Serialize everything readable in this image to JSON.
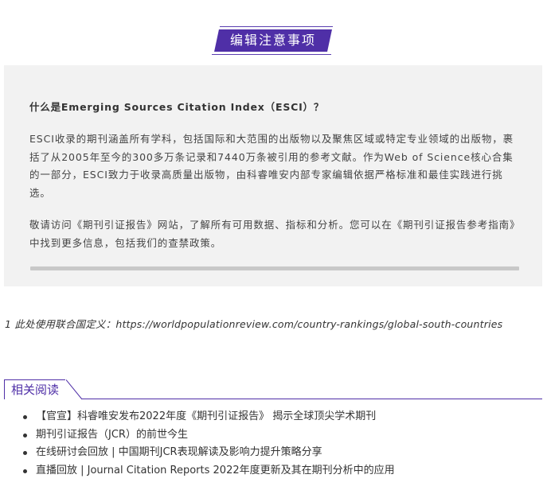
{
  "badge": {
    "label": "编辑注意事项"
  },
  "note": {
    "heading": "什么是Emerging Sources Citation Index（ESCI）？",
    "para1": "ESCI收录的期刊涵盖所有学科，包括国际和大范围的出版物以及聚焦区域或特定专业领域的出版物，裹括了从2005年至今的300多万条记录和7440万条被引用的参考文献。作为Web of Science核心合集的一部分，ESCI致力于收录高质量出版物，由科睿唯安内部专家编辑依据严格标准和最佳实践进行挑选。",
    "para2": "敬请访问《期刊引证报告》网站，了解所有可用数据、指标和分析。您可以在《期刊引证报告参考指南》中找到更多信息，包括我们的查禁政策。"
  },
  "footnote": "1 此处使用联合国定义：https://worldpopulationreview.com/country-rankings/global-south-countries",
  "related": {
    "title": "相关阅读",
    "items": [
      {
        "text": "【官宣】科睿唯安发布2022年度《期刊引证报告》 揭示全球顶尖学术期刊"
      },
      {
        "text": "期刊引证报告（JCR）的前世今生"
      },
      {
        "text": "在线研讨会回放 | 中国期刊JCR表现解读及影响力提升策略分享"
      },
      {
        "text": "直播回放 | Journal Citation Reports 2022年度更新及其在期刊分析中的应用"
      }
    ]
  },
  "colors": {
    "accent": "#4f2fa7",
    "box_bg": "#f2f2f2"
  }
}
